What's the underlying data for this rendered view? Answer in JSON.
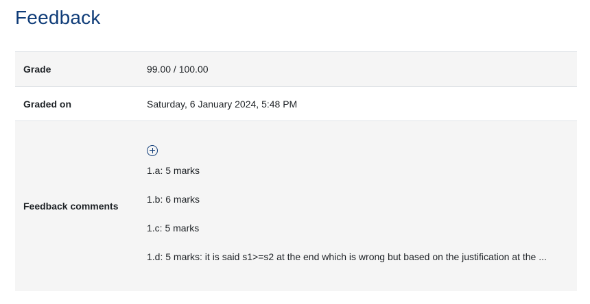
{
  "page": {
    "title": "Feedback"
  },
  "table": {
    "grade": {
      "label": "Grade",
      "value": "99.00 / 100.00"
    },
    "graded_on": {
      "label": "Graded on",
      "value": "Saturday, 6 January 2024, 5:48 PM"
    },
    "feedback_comments": {
      "label": "Feedback comments",
      "expand_icon": "plus-circle-icon",
      "lines": [
        "1.a: 5 marks",
        "1.b: 6 marks",
        "1.c: 5 marks",
        "1.d: 5 marks: it is said s1>=s2 at the end which is wrong but based on the justification at the ..."
      ]
    }
  },
  "colors": {
    "title": "#0f3c78",
    "row_shaded": "#f5f5f5",
    "border": "#dee2e6"
  }
}
